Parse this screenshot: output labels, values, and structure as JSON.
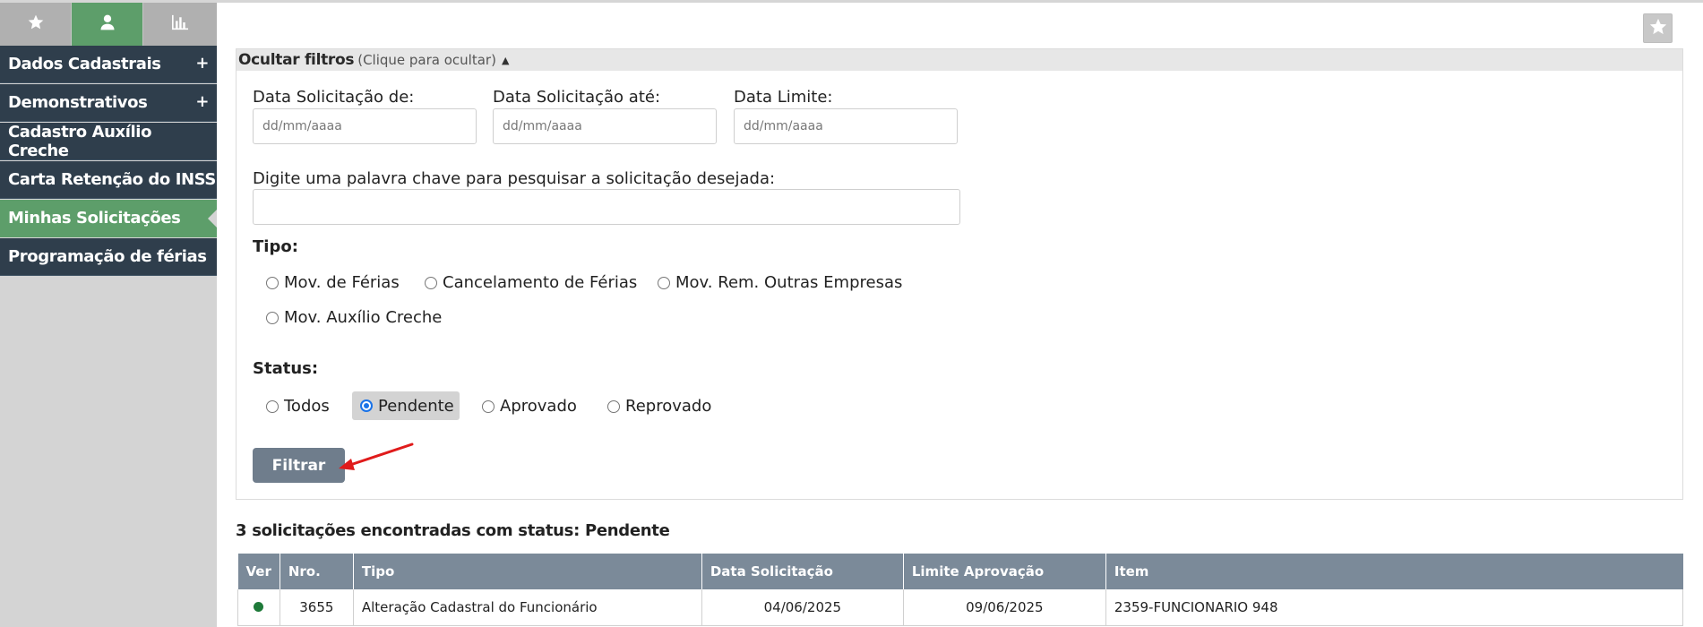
{
  "sidebar": {
    "tabs": [
      {
        "icon": "star-icon"
      },
      {
        "icon": "user-icon",
        "active": true
      },
      {
        "icon": "bar-chart-icon"
      }
    ],
    "items": [
      {
        "label": "Dados Cadastrais",
        "expand": "+"
      },
      {
        "label": "Demonstrativos",
        "expand": "+"
      },
      {
        "label": "Cadastro Auxílio Creche"
      },
      {
        "label": "Carta Retenção do INSS"
      },
      {
        "label": "Minhas Solicitações",
        "active": true
      },
      {
        "label": "Programação de férias"
      }
    ]
  },
  "favorite": {
    "icon": "star-icon"
  },
  "filters": {
    "header_title": "Ocultar filtros",
    "header_hint": "(Clique para ocultar)",
    "header_caret": "▲",
    "date_from_label": "Data Solicitação de:",
    "date_from_placeholder": "dd/mm/aaaa",
    "date_to_label": "Data Solicitação até:",
    "date_to_placeholder": "dd/mm/aaaa",
    "date_limit_label": "Data Limite:",
    "date_limit_placeholder": "dd/mm/aaaa",
    "keyword_label": "Digite uma palavra chave para pesquisar a solicitação desejada:",
    "keyword_value": "",
    "tipo_label": "Tipo:",
    "tipo_options": [
      "Mov. de Férias",
      "Cancelamento de Férias",
      "Mov. Rem. Outras Empresas",
      "Mov. Auxílio Creche"
    ],
    "status_label": "Status:",
    "status_options": [
      "Todos",
      "Pendente",
      "Aprovado",
      "Reprovado"
    ],
    "status_selected": "Pendente",
    "filter_button": "Filtrar"
  },
  "results": {
    "title": "3 solicitações encontradas com status: Pendente",
    "columns": [
      "Ver",
      "Nro.",
      "Tipo",
      "Data Solicitação",
      "Limite Aprovação",
      "Item"
    ],
    "rows": [
      {
        "nro": "3655",
        "tipo": "Alteração Cadastral do Funcionário",
        "data": "04/06/2025",
        "limite": "09/06/2025",
        "item": "2359-FUNCIONARIO 948"
      }
    ]
  },
  "colors": {
    "sidebar_dark": "#2f3e4c",
    "sidebar_active": "#5d9e6a",
    "table_header": "#7b8a99",
    "button": "#6f7d8c",
    "annotation_arrow": "#e01b1b"
  }
}
